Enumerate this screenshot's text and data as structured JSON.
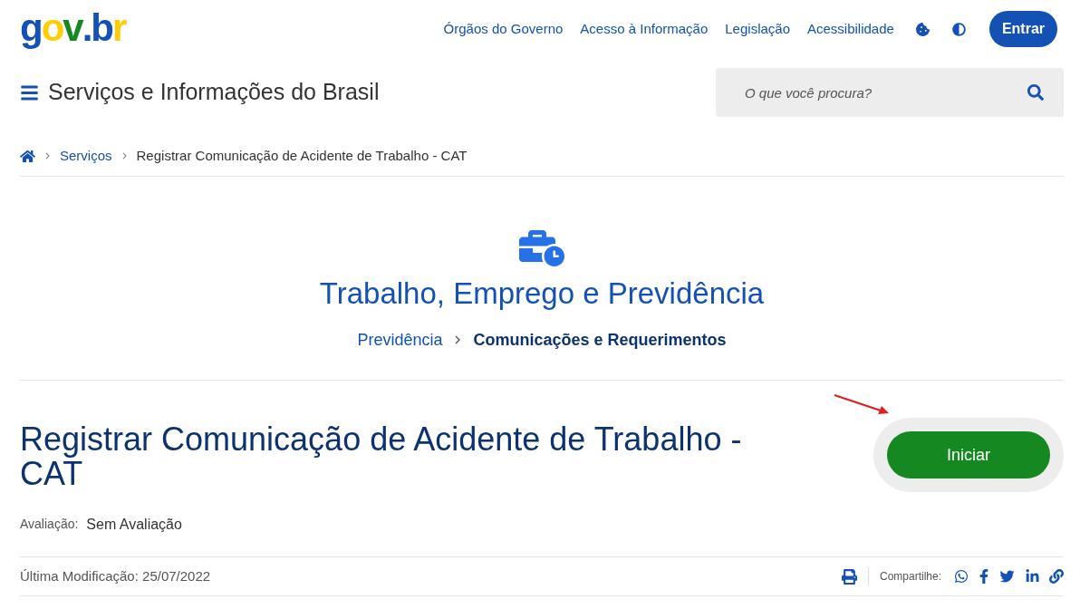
{
  "header": {
    "logo": [
      {
        "text": "g",
        "color": "#1351b4"
      },
      {
        "text": "o",
        "color": "#ffcd07"
      },
      {
        "text": "v",
        "color": "#168821"
      },
      {
        "text": ".",
        "color": "#1351b4"
      },
      {
        "text": "b",
        "color": "#1351b4"
      },
      {
        "text": "r",
        "color": "#ffcd07"
      }
    ],
    "links": [
      "Órgãos do Governo",
      "Acesso à Informação",
      "Legislação",
      "Acessibilidade"
    ],
    "login_button": "Entrar"
  },
  "site_title": "Serviços e Informações do Brasil",
  "search": {
    "placeholder": "O que você procura?"
  },
  "breadcrumb": [
    {
      "label": "Serviços",
      "kind": "link"
    },
    {
      "label": "Registrar Comunicação de Acidente de Trabalho - CAT",
      "kind": "current"
    }
  ],
  "category": {
    "title": "Trabalho, Emprego e Previdência",
    "path": [
      {
        "label": "Previdência",
        "kind": "link"
      },
      {
        "label": "Comunicações e Requerimentos",
        "kind": "current"
      }
    ]
  },
  "service": {
    "title": "Registrar Comunicação de Acidente de Trabalho - CAT",
    "start_button": "Iniciar",
    "rating_label": "Avaliação:",
    "rating_value": "Sem Avaliação"
  },
  "footer": {
    "last_modified": "Última Modificação: 25/07/2022",
    "share_label": "Compartilhe:"
  }
}
